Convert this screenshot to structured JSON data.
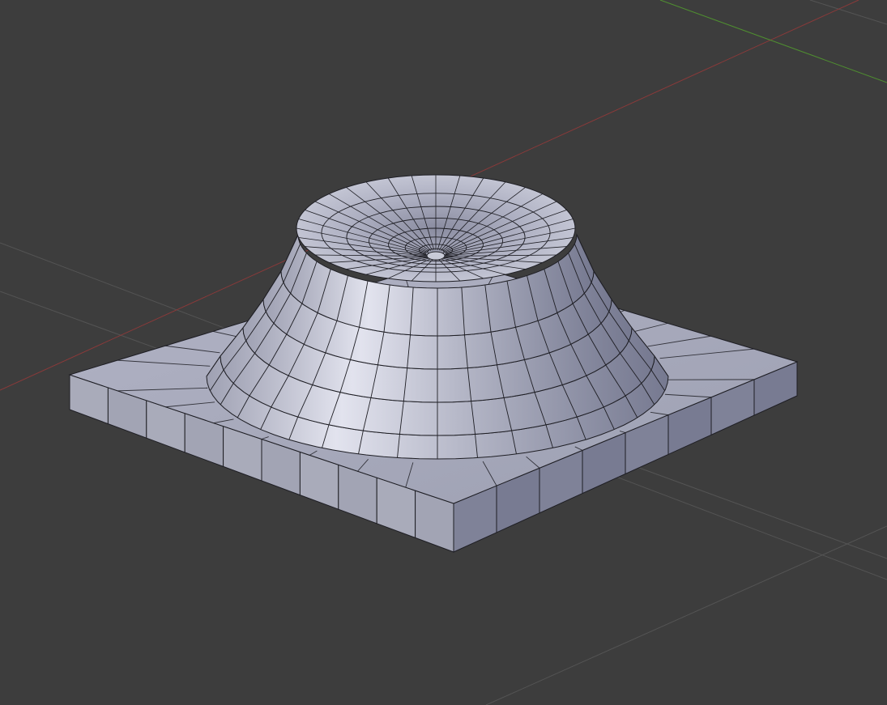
{
  "viewport": {
    "view": "3d-viewport-perspective",
    "shading": "solid",
    "show_wireframe_overlay": true,
    "colors": {
      "background": "#3d3d3d",
      "grid_line": "#545454",
      "x_axis": "#8a3a3a",
      "y_axis": "#4f8f30",
      "mesh_light": "#d4d5e2",
      "mesh_mid": "#a9abbd",
      "mesh_dark": "#777a90",
      "wire": "#1e1e24"
    }
  },
  "mesh": {
    "type": "square-base-with-stepped-dome",
    "base_edge_segments": 10,
    "dome_radial_segments": 36,
    "dome_steps": 5,
    "top_dish": "concave",
    "selected": false
  }
}
